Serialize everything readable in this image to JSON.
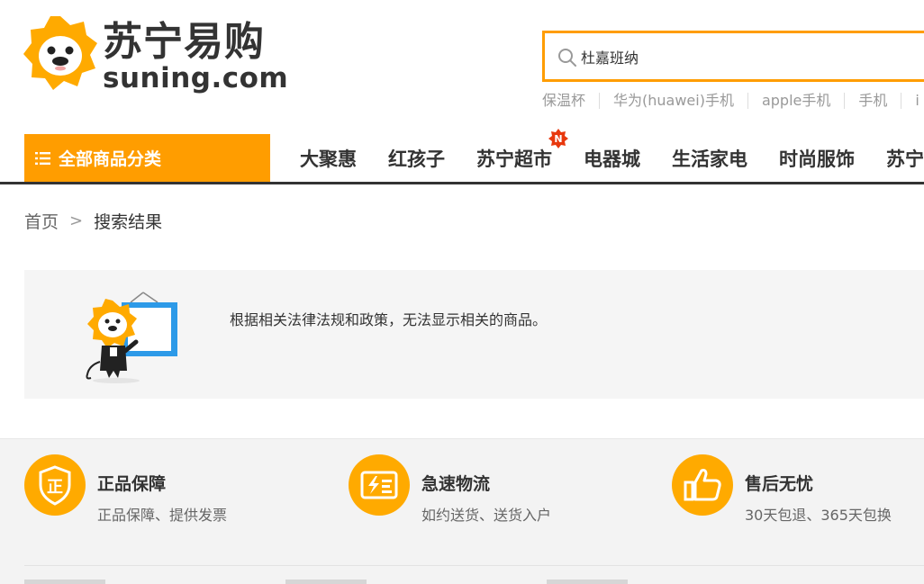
{
  "logo": {
    "cn": "苏宁易购",
    "en": "suning.com"
  },
  "search": {
    "value": "杜嘉班纳",
    "icon": "search-icon"
  },
  "hot_words": [
    "保温杯",
    "华为(huawei)手机",
    "apple手机",
    "手机",
    "i"
  ],
  "nav": {
    "all_categories": "全部商品分类",
    "items": [
      {
        "label": "大聚惠"
      },
      {
        "label": "红孩子"
      },
      {
        "label": "苏宁超市",
        "badge": "N"
      },
      {
        "label": "电器城"
      },
      {
        "label": "生活家电"
      },
      {
        "label": "时尚服饰"
      },
      {
        "label": "苏宁"
      }
    ]
  },
  "breadcrumb": {
    "home": "首页",
    "separator": ">",
    "current": "搜索结果"
  },
  "notice": {
    "message": "根据相关法律法规和政策，无法显示相关的商品。"
  },
  "services": [
    {
      "icon": "shield-icon",
      "icon_text": "正",
      "title": "正品保障",
      "desc": "正品保障、提供发票"
    },
    {
      "icon": "bolt-box-icon",
      "title": "急速物流",
      "desc": "如约送货、送货入户"
    },
    {
      "icon": "thumbs-up-icon",
      "title": "售后无忧",
      "desc": "30天包退、365天包换"
    }
  ],
  "colors": {
    "brand_orange": "#ff9d00",
    "nav_border": "#333333",
    "badge_red": "#e8380d",
    "frame_blue": "#2d9ae8"
  }
}
